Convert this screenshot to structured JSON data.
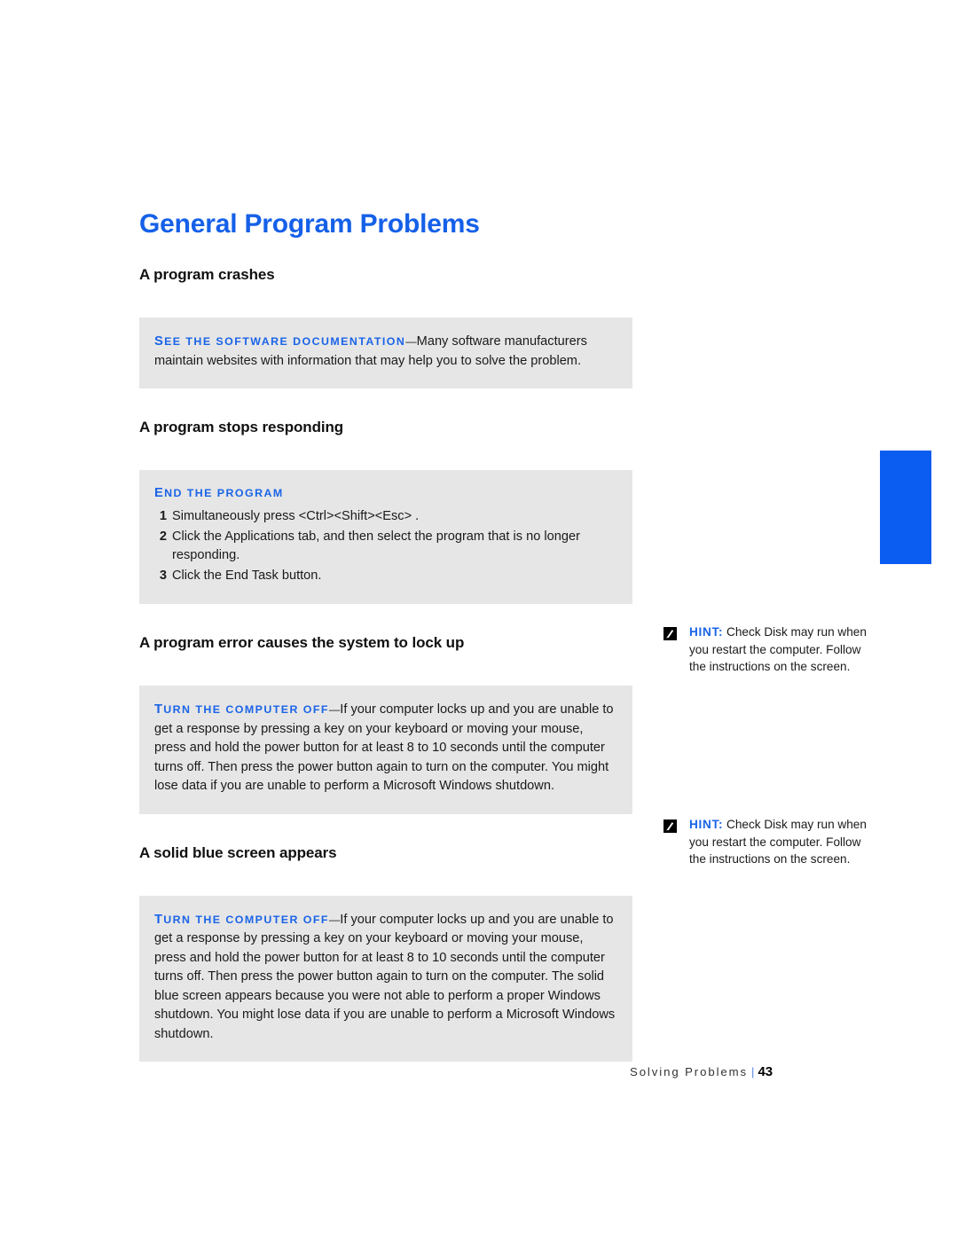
{
  "page": {
    "title": "General Program Problems",
    "accent_color": "#1560e8",
    "callout_bg": "#e6e6e6",
    "tab_color": "#0b5cf0"
  },
  "sections": [
    {
      "heading": "A program crashes",
      "callout": {
        "lead_first": "S",
        "lead_rest": "EE THE SOFTWARE DOCUMENTATION",
        "dash": "—",
        "body": "Many software manufacturers maintain websites with information that may help you to solve the problem."
      }
    },
    {
      "heading": "A program stops responding",
      "callout": {
        "lead_first": "E",
        "lead_rest": "ND THE PROGRAM",
        "steps": [
          {
            "num": "1",
            "text": "Simultaneously press <Ctrl><Shift><Esc> ."
          },
          {
            "num": "2",
            "text": "Click the Applications tab, and then select the program that is no longer responding."
          },
          {
            "num": "3",
            "text": "Click the End Task button."
          }
        ]
      }
    },
    {
      "heading": "A program error causes the system to lock up",
      "callout": {
        "lead_first": "T",
        "lead_rest": "URN THE COMPUTER OFF",
        "dash": "—",
        "body": "If your computer locks up and you are unable to get a response by pressing a key on your keyboard or moving your mouse, press and hold the power button for at least 8 to 10 seconds until the computer turns off. Then press the power button again to turn on the computer. You might lose data if you are unable to perform a Microsoft Windows shutdown."
      }
    },
    {
      "heading": "A solid blue screen appears",
      "callout": {
        "lead_first": "T",
        "lead_rest": "URN THE COMPUTER OFF",
        "dash": "—",
        "body": "If your computer locks up and you are unable to get a response by pressing a key on your keyboard or moving your mouse, press and hold the power button for at least 8 to 10 seconds until the computer turns off. Then press the power button again to turn on the computer. The solid blue screen appears because you were not able to perform a proper Windows shutdown. You might lose data if you are unable to perform a Microsoft Windows shutdown."
      }
    }
  ],
  "hints": [
    {
      "label": "HINT:",
      "text": " Check Disk may run when you restart the computer. Follow the instructions on the screen."
    },
    {
      "label": "HINT:",
      "text": " Check Disk may run when you restart the computer. Follow the instructions on the screen."
    }
  ],
  "footer": {
    "chapter": "Solving Problems",
    "separator": "|",
    "page_number": "43"
  }
}
